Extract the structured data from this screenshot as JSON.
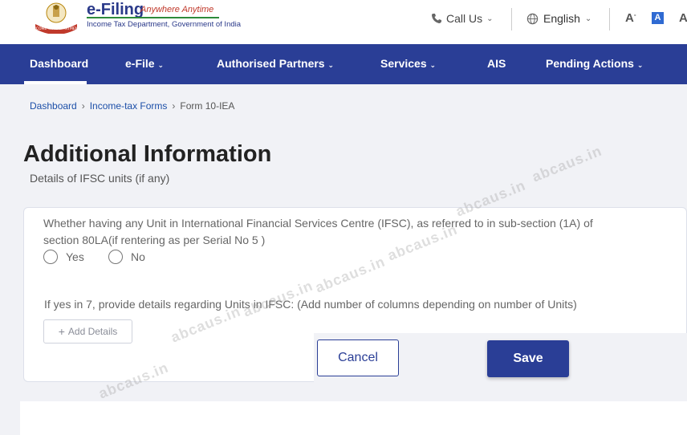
{
  "header": {
    "brand_title": "e-Filing",
    "brand_tagline": "Anywhere Anytime",
    "brand_subtitle": "Income Tax Department, Government of India",
    "logo_text": "INCOME TAX DEPARTMENT",
    "call_us_label": "Call Us",
    "language_label": "English",
    "font_decrease_label": "A",
    "font_normal_label": "A",
    "font_increase_label": "A"
  },
  "nav": {
    "items": [
      {
        "label": "Dashboard"
      },
      {
        "label": "e-File"
      },
      {
        "label": "Authorised Partners"
      },
      {
        "label": "Services"
      },
      {
        "label": "AIS"
      },
      {
        "label": "Pending Actions"
      }
    ]
  },
  "breadcrumb": {
    "items": [
      "Dashboard",
      "Income-tax Forms"
    ],
    "current": "Form 10-IEA"
  },
  "page": {
    "title": "Additional Information",
    "subtitle": "Details of IFSC units (if any)"
  },
  "form": {
    "question1": "Whether having any Unit in International Financial Services Centre (IFSC), as referred to in sub-section (1A) of section 80LA(if rentering as per Serial No 5 )",
    "option_yes": "Yes",
    "option_no": "No",
    "question2": "If yes in 7, provide details regarding Units in IFSC: (Add number of columns depending on number of Units)",
    "add_details_label": "Add Details"
  },
  "actions": {
    "cancel_label": "Cancel",
    "save_label": "Save"
  },
  "watermark": {
    "text": "abcaus.in"
  },
  "colors": {
    "nav_bg": "#2a3e96",
    "link": "#1c4fa8",
    "save_bg": "#2a3e96"
  }
}
